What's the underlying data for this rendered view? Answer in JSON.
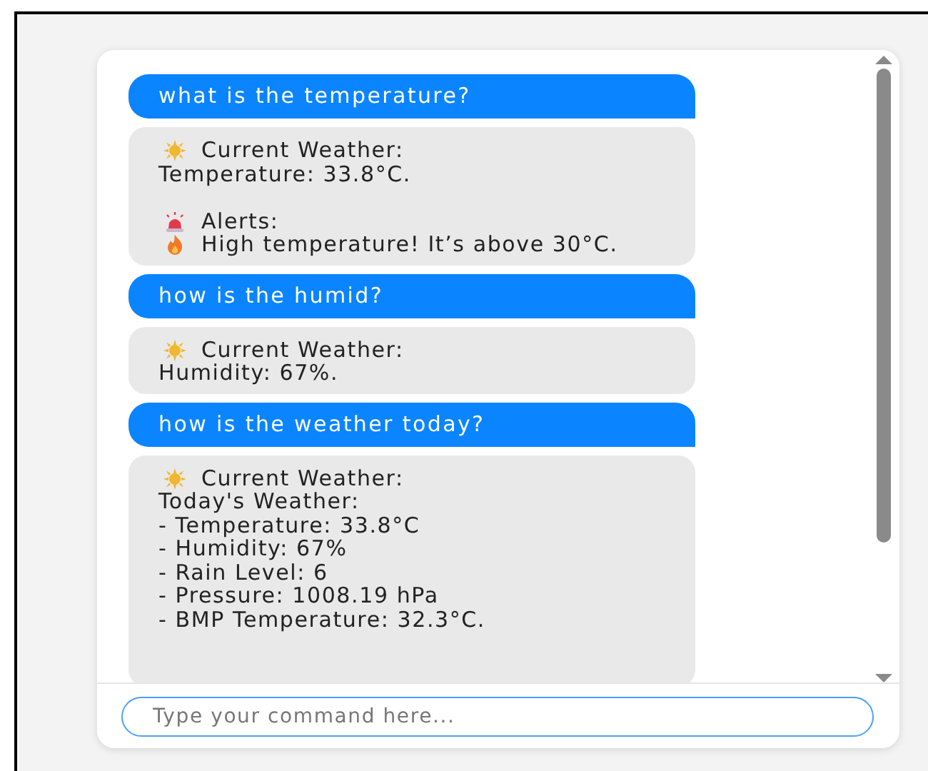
{
  "messages": [
    {
      "kind": "user",
      "text": "what is the temperature?"
    },
    {
      "kind": "bot",
      "lines": [
        {
          "kind": "weather",
          "text": "Current Weather:"
        },
        {
          "kind": "text",
          "text": "Temperature: 33.8°C."
        },
        {
          "kind": "blank"
        },
        {
          "kind": "alert",
          "text": "Alerts:"
        },
        {
          "kind": "heat",
          "text": "High temperature! It’s above 30°C."
        }
      ]
    },
    {
      "kind": "user",
      "text": "how is the humid?"
    },
    {
      "kind": "bot",
      "lines": [
        {
          "kind": "weather",
          "text": "Current Weather:"
        },
        {
          "kind": "text",
          "text": "Humidity: 67%."
        }
      ]
    },
    {
      "kind": "user",
      "text": "how is the weather today?"
    },
    {
      "kind": "bot",
      "lines": [
        {
          "kind": "weather",
          "text": "Current Weather:"
        },
        {
          "kind": "text",
          "text": "Today's Weather:"
        },
        {
          "kind": "text",
          "text": "- Temperature: 33.8°C"
        },
        {
          "kind": "text",
          "text": "- Humidity: 67%"
        },
        {
          "kind": "text",
          "text": "- Rain Level: 6"
        },
        {
          "kind": "text",
          "text": "- Pressure: 1008.19 hPa"
        },
        {
          "kind": "text",
          "text": "- BMP Temperature: 32.3°C."
        },
        {
          "kind": "blank"
        },
        {
          "kind": "blank"
        }
      ]
    }
  ],
  "input": {
    "placeholder": "Type your command here..."
  }
}
